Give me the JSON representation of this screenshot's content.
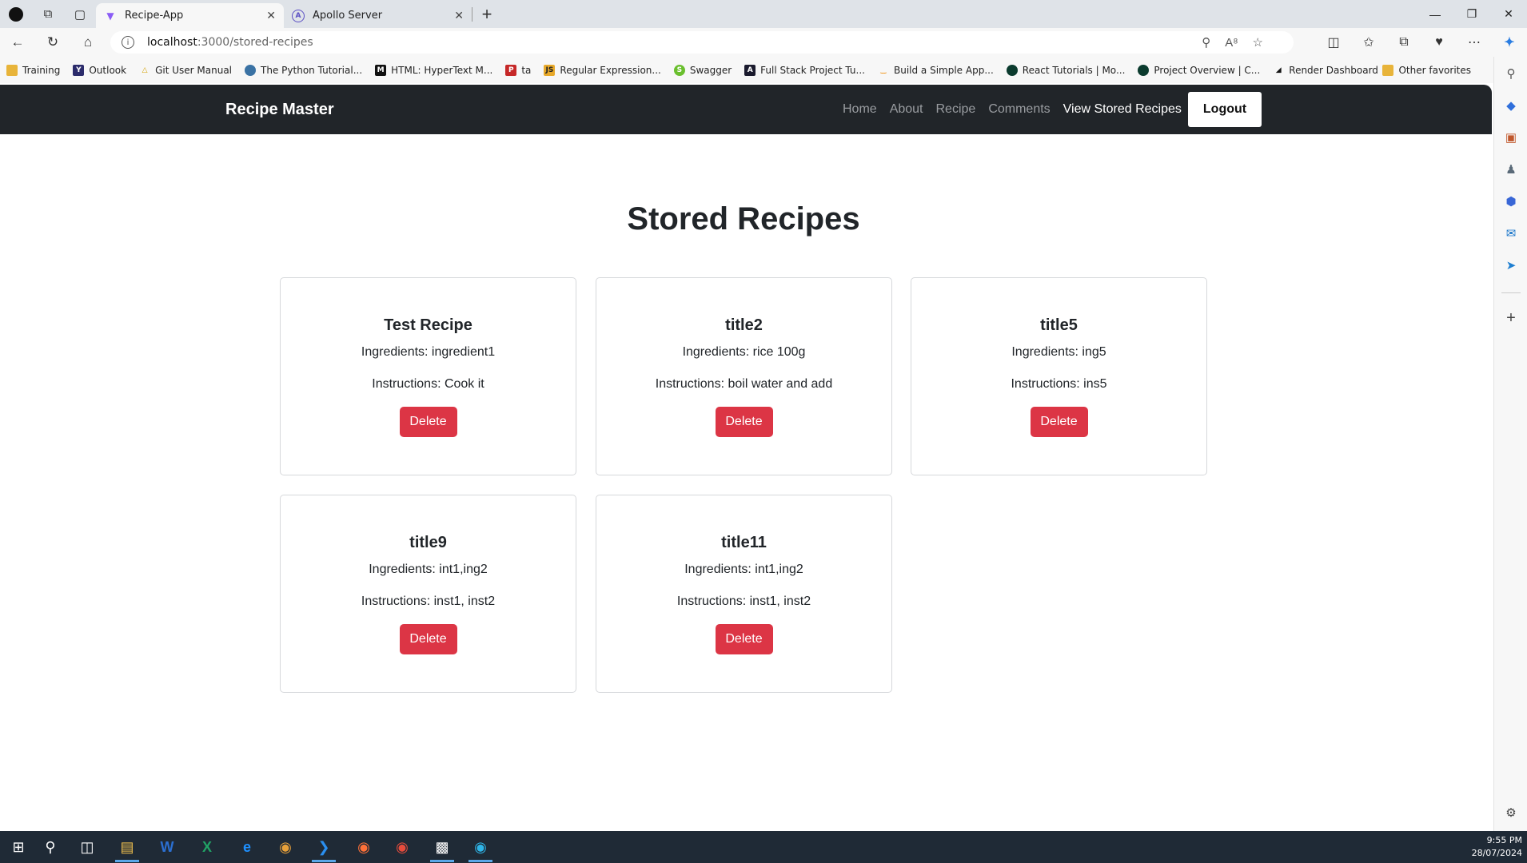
{
  "browser": {
    "tabs": [
      {
        "title": "Recipe-App",
        "active": true
      },
      {
        "title": "Apollo Server",
        "active": false
      }
    ],
    "url_host": "localhost",
    "url_path": ":3000/stored-recipes",
    "bookmarks": [
      "Training",
      "Outlook",
      "Git User Manual",
      "The Python Tutorial...",
      "HTML: HyperText M...",
      "ta",
      "Regular Expression...",
      "Swagger",
      "Full Stack Project Tu...",
      "Build a Simple App...",
      "React Tutorials | Mo...",
      "Project Overview | C...",
      "Render Dashboard"
    ],
    "other_favorites": "Other favorites"
  },
  "app": {
    "brand": "Recipe Master",
    "nav": [
      "Home",
      "About",
      "Recipe",
      "Comments",
      "View Stored Recipes"
    ],
    "active_nav": "View Stored Recipes",
    "logout_label": "Logout"
  },
  "page": {
    "title": "Stored Recipes",
    "recipes": [
      {
        "title": "Test Recipe",
        "ingredients": "Ingredients: ingredient1",
        "instructions": "Instructions: Cook it",
        "delete_label": "Delete"
      },
      {
        "title": "title2",
        "ingredients": "Ingredients: rice 100g",
        "instructions": "Instructions: boil water and add",
        "delete_label": "Delete"
      },
      {
        "title": "title5",
        "ingredients": "Ingredients: ing5",
        "instructions": "Instructions: ins5",
        "delete_label": "Delete"
      },
      {
        "title": "title9",
        "ingredients": "Ingredients: int1,ing2",
        "instructions": "Instructions: inst1, inst2",
        "delete_label": "Delete"
      },
      {
        "title": "title11",
        "ingredients": "Ingredients: int1,ing2",
        "instructions": "Instructions: inst1, inst2",
        "delete_label": "Delete"
      }
    ]
  },
  "taskbar": {
    "time": "9:55 PM",
    "date": "28/07/2024"
  },
  "colors": {
    "navbar_bg": "#212529",
    "delete_button": "#dc3545",
    "taskbar_bg": "#1f2a36"
  }
}
